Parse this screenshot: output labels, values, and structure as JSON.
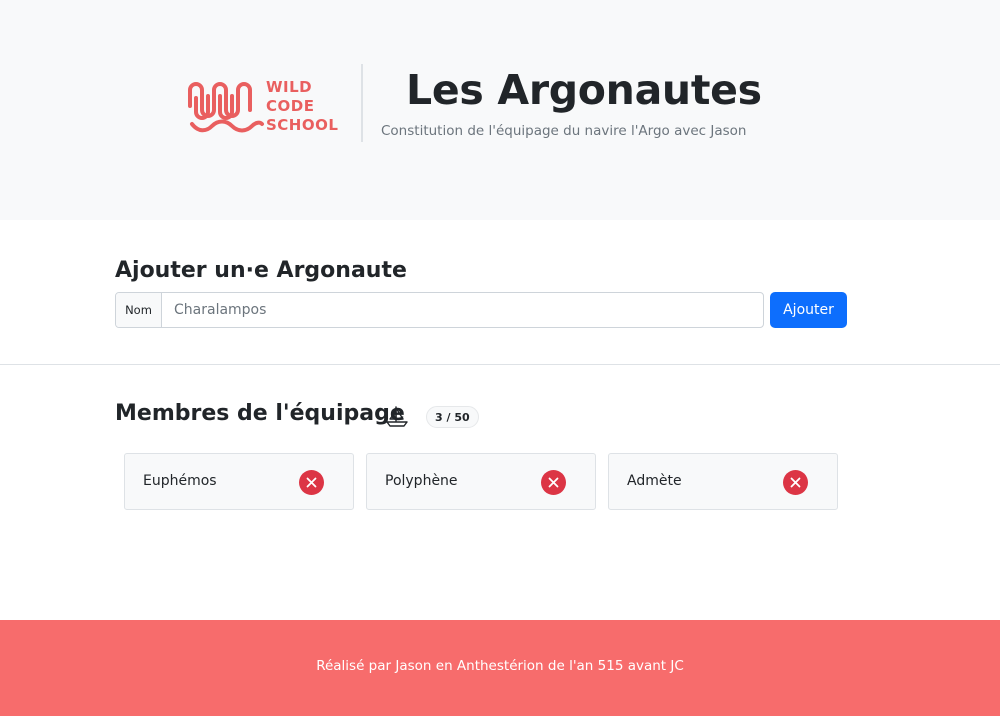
{
  "header": {
    "logo_lines": [
      "WILD",
      "CODE",
      "SCHOOL"
    ],
    "title": "Les Argonautes",
    "subtitle": "Constitution de l'équipage du navire l'Argo avec Jason"
  },
  "form": {
    "title": "Ajouter un·e Argonaute",
    "prefix": "Nom",
    "placeholder": "Charalampos",
    "value": "",
    "submit_label": "Ajouter"
  },
  "crew": {
    "title": "Membres de l'équipage",
    "icon": "sailboat-icon",
    "count": "3 / 50",
    "members": [
      {
        "name": "Euphémos"
      },
      {
        "name": "Polyphène"
      },
      {
        "name": "Admète"
      }
    ]
  },
  "footer": {
    "text": "Réalisé par Jason en Anthestérion de l'an 515 avant JC"
  },
  "colors": {
    "brand": "#f76c6c",
    "primary": "#0d6efd",
    "danger": "#dc3545"
  }
}
